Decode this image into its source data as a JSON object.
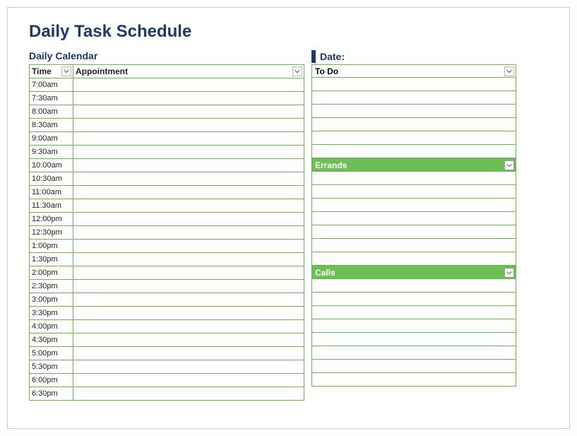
{
  "title": "Daily Task Schedule",
  "left": {
    "heading": "Daily Calendar",
    "columns": {
      "time": "Time",
      "appointment": "Appointment"
    },
    "rows": [
      {
        "time": "7:00am",
        "appt": ""
      },
      {
        "time": "7:30am",
        "appt": ""
      },
      {
        "time": "8:00am",
        "appt": ""
      },
      {
        "time": "8:30am",
        "appt": ""
      },
      {
        "time": "9:00am",
        "appt": ""
      },
      {
        "time": "9:30am",
        "appt": ""
      },
      {
        "time": "10:00am",
        "appt": ""
      },
      {
        "time": "10:30am",
        "appt": ""
      },
      {
        "time": "11:00am",
        "appt": ""
      },
      {
        "time": "11:30am",
        "appt": ""
      },
      {
        "time": "12:00pm",
        "appt": ""
      },
      {
        "time": "12:30pm",
        "appt": ""
      },
      {
        "time": "1:00pm",
        "appt": ""
      },
      {
        "time": "1:30pm",
        "appt": ""
      },
      {
        "time": "2:00pm",
        "appt": ""
      },
      {
        "time": "2:30pm",
        "appt": ""
      },
      {
        "time": "3:00pm",
        "appt": ""
      },
      {
        "time": "3:30pm",
        "appt": ""
      },
      {
        "time": "4:00pm",
        "appt": ""
      },
      {
        "time": "4:30pm",
        "appt": ""
      },
      {
        "time": "5:00pm",
        "appt": ""
      },
      {
        "time": "5:30pm",
        "appt": ""
      },
      {
        "time": "6:00pm",
        "appt": ""
      },
      {
        "time": "6:30pm",
        "appt": ""
      }
    ]
  },
  "right": {
    "date_label": "Date:",
    "sections": [
      {
        "title": "To Do",
        "style": "white",
        "rows": 6
      },
      {
        "title": "Errands",
        "style": "green",
        "rows": 7
      },
      {
        "title": "Calls",
        "style": "green",
        "rows": 8
      }
    ]
  }
}
